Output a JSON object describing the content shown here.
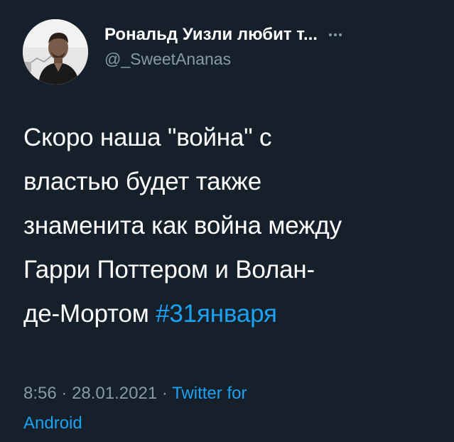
{
  "author": {
    "display_name": "Рональд Уизли любит т...",
    "handle": "@_SweetAnanas",
    "avatar_icon": "person-photo-avatar"
  },
  "more_icon": "ellipsis-icon",
  "tweet": {
    "lines": [
      "Скоро наша \"война\" с",
      "властью будет также",
      "знаменита как война между",
      "Гарри Поттером и Волан-",
      "де-Мортом "
    ],
    "hashtag": "#31января"
  },
  "meta": {
    "time": "8:56",
    "separator": "·",
    "date": "28.01.2021",
    "source_line1": "Twitter for",
    "source_line2": "Android"
  },
  "colors": {
    "background": "#15202b",
    "text": "#ffffff",
    "secondary": "#8899a6",
    "link": "#1da1f2"
  }
}
